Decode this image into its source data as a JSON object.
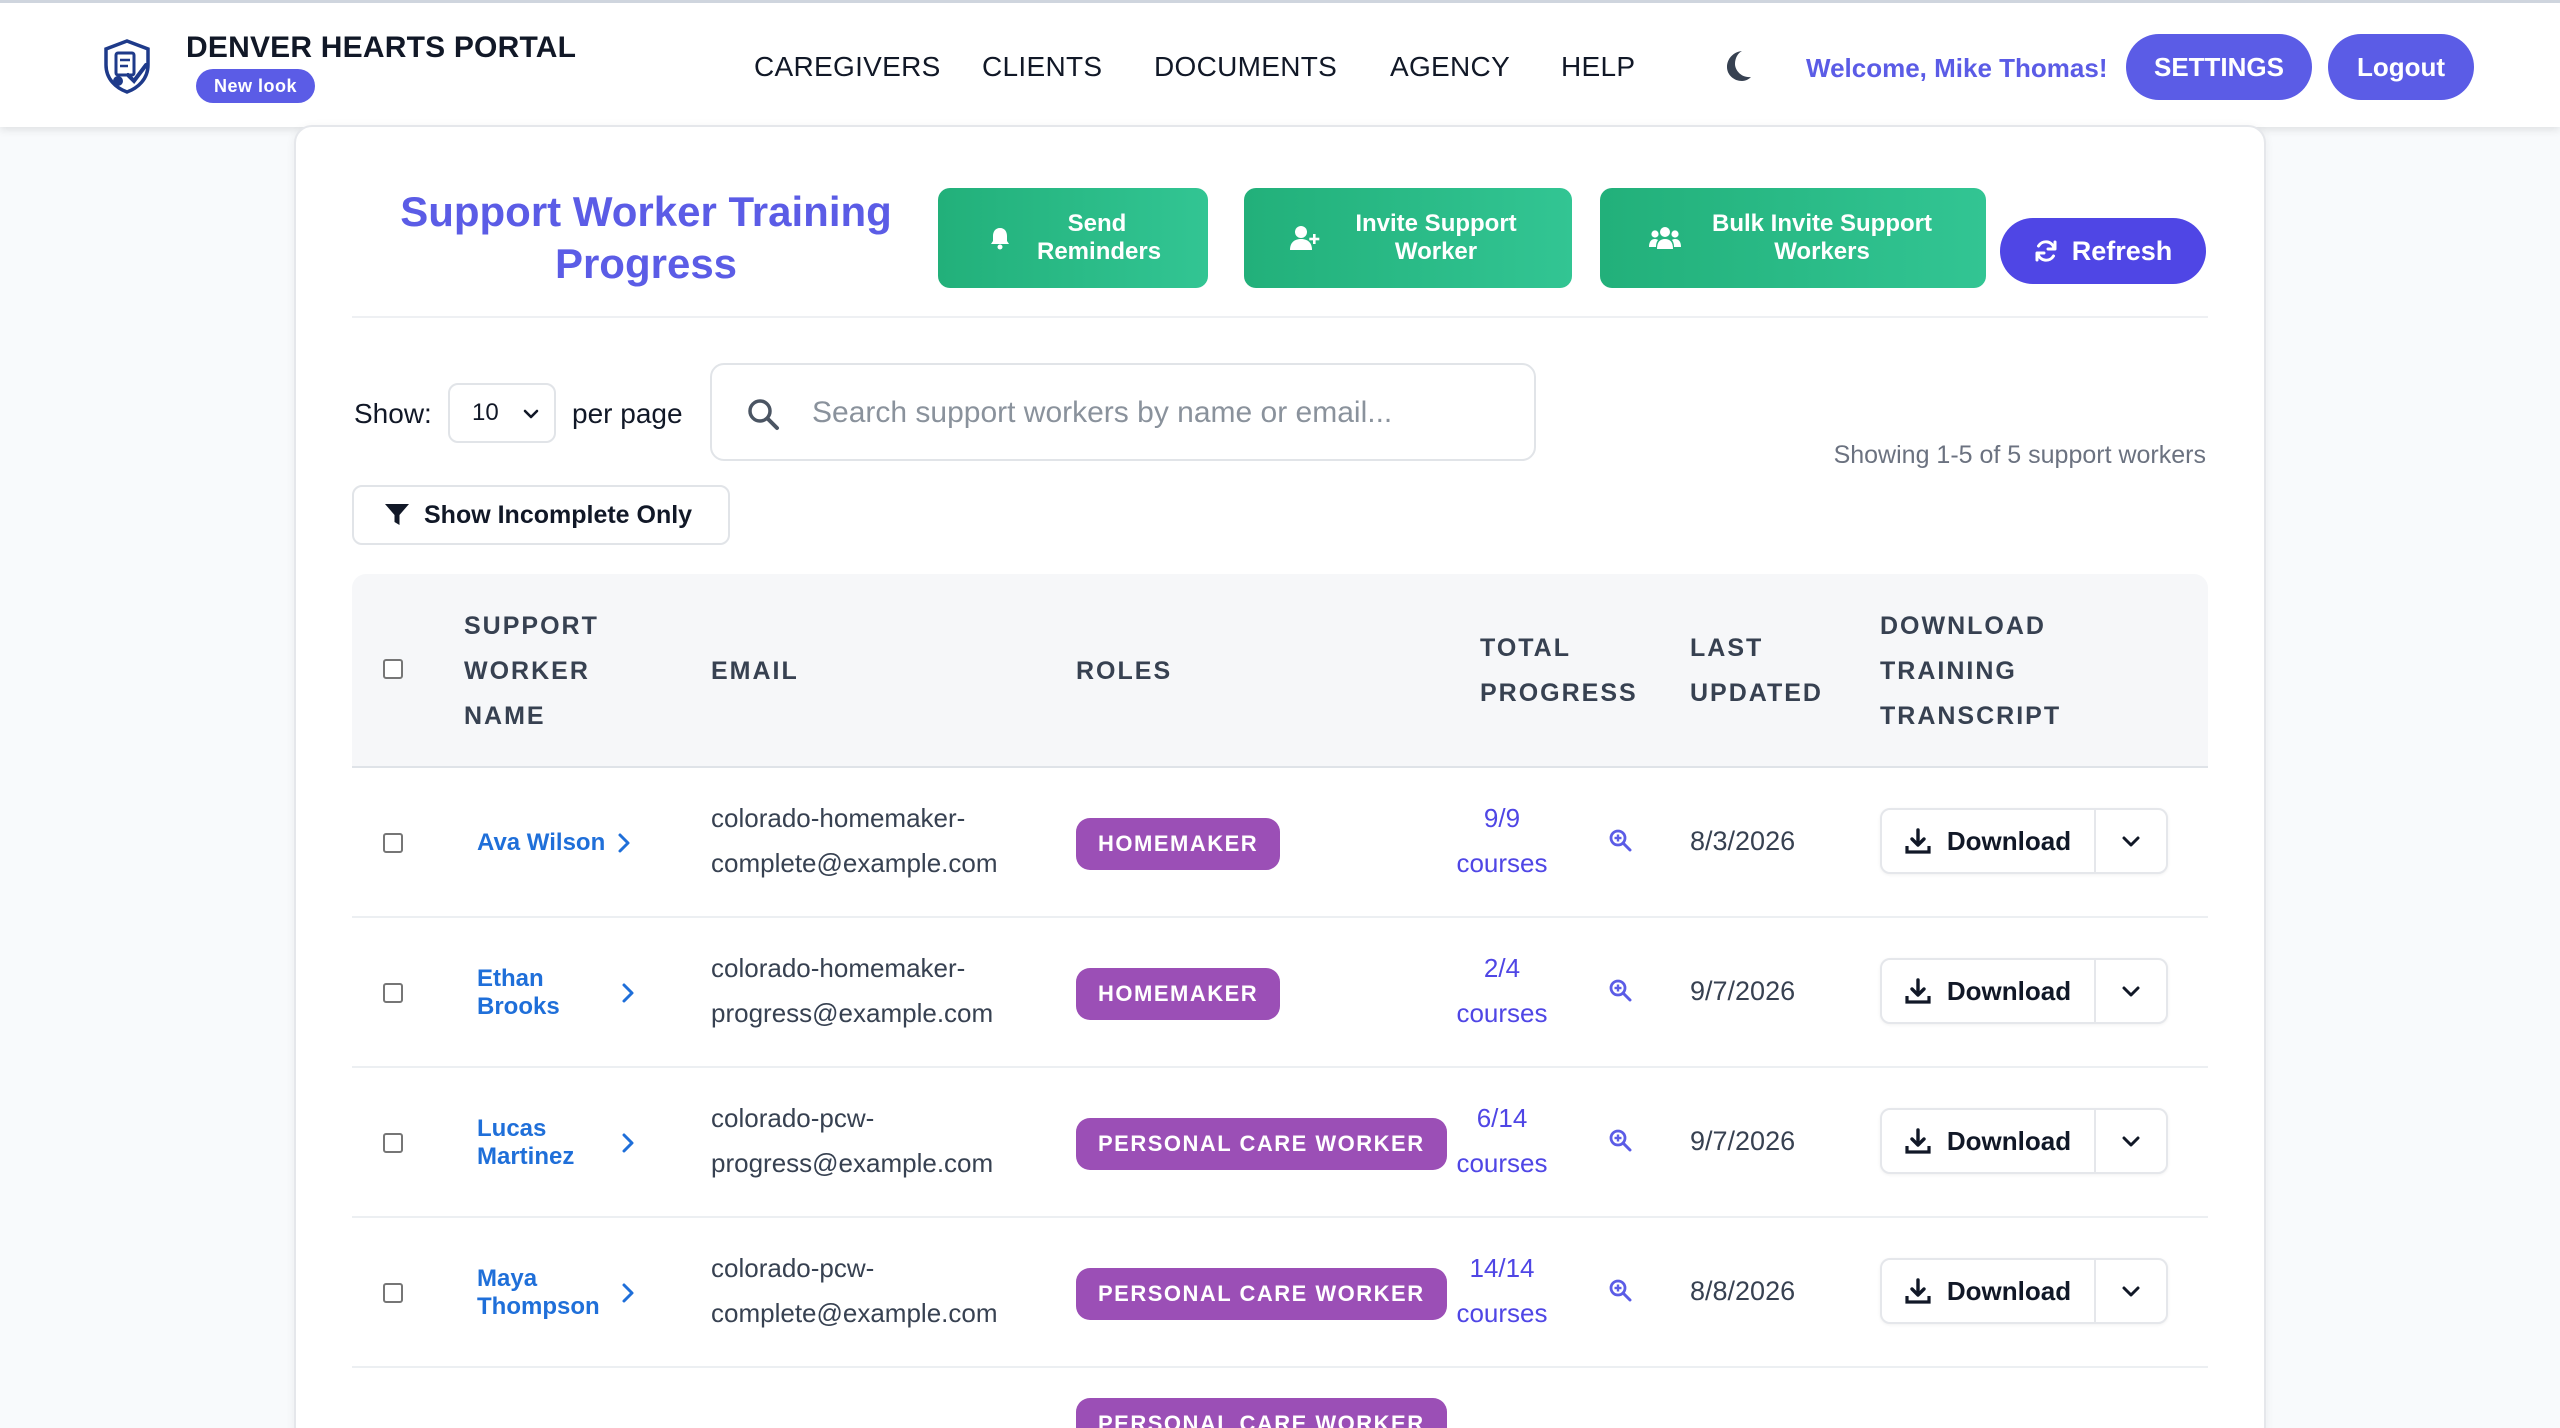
{
  "header": {
    "brand": "DENVER HEARTS PORTAL",
    "badge": "New look",
    "nav": [
      "CAREGIVERS",
      "CLIENTS",
      "DOCUMENTS",
      "AGENCY",
      "HELP"
    ],
    "welcome": "Welcome, Mike Thomas!",
    "settings_label": "SETTINGS",
    "logout_label": "Logout"
  },
  "page": {
    "title": "Support Worker Training Progress",
    "actions": {
      "send_reminders": "Send Reminders",
      "invite": "Invite Support Worker",
      "bulk_invite": "Bulk Invite Support Workers",
      "refresh": "Refresh"
    },
    "controls": {
      "show_label": "Show:",
      "per_page_value": "10",
      "per_page_label": "per page",
      "search_placeholder": "Search support workers by name or email...",
      "showing": "Showing 1-5 of 5 support workers",
      "incomplete_filter": "Show Incomplete Only"
    }
  },
  "table": {
    "headers": {
      "name": "SUPPORT WORKER NAME",
      "email": "EMAIL",
      "roles": "ROLES",
      "progress": "TOTAL PROGRESS",
      "updated": "LAST UPDATED",
      "download": "DOWNLOAD TRAINING TRANSCRIPT"
    },
    "download_label": "Download",
    "rows": [
      {
        "name": "Ava Wilson",
        "email": "colorado-homemaker-complete@example.com",
        "role": "HOMEMAKER",
        "progress": "9/9 courses",
        "updated": "8/3/2026"
      },
      {
        "name": "Ethan Brooks",
        "email": "colorado-homemaker-progress@example.com",
        "role": "HOMEMAKER",
        "progress": "2/4 courses",
        "updated": "9/7/2026"
      },
      {
        "name": "Lucas Martinez",
        "email": "colorado-pcw-progress@example.com",
        "role": "PERSONAL CARE WORKER",
        "progress": "6/14 courses",
        "updated": "9/7/2026"
      },
      {
        "name": "Maya Thompson",
        "email": "colorado-pcw-complete@example.com",
        "role": "PERSONAL CARE WORKER",
        "progress": "14/14 courses",
        "updated": "8/8/2026"
      },
      {
        "name": "",
        "email": "",
        "role": "PERSONAL CARE WORKER",
        "progress": "",
        "updated": ""
      }
    ]
  },
  "colors": {
    "accent": "#5b5ce6",
    "green": "#27b882",
    "role_badge": "#9b4fb6",
    "link": "#1f6fd9"
  }
}
